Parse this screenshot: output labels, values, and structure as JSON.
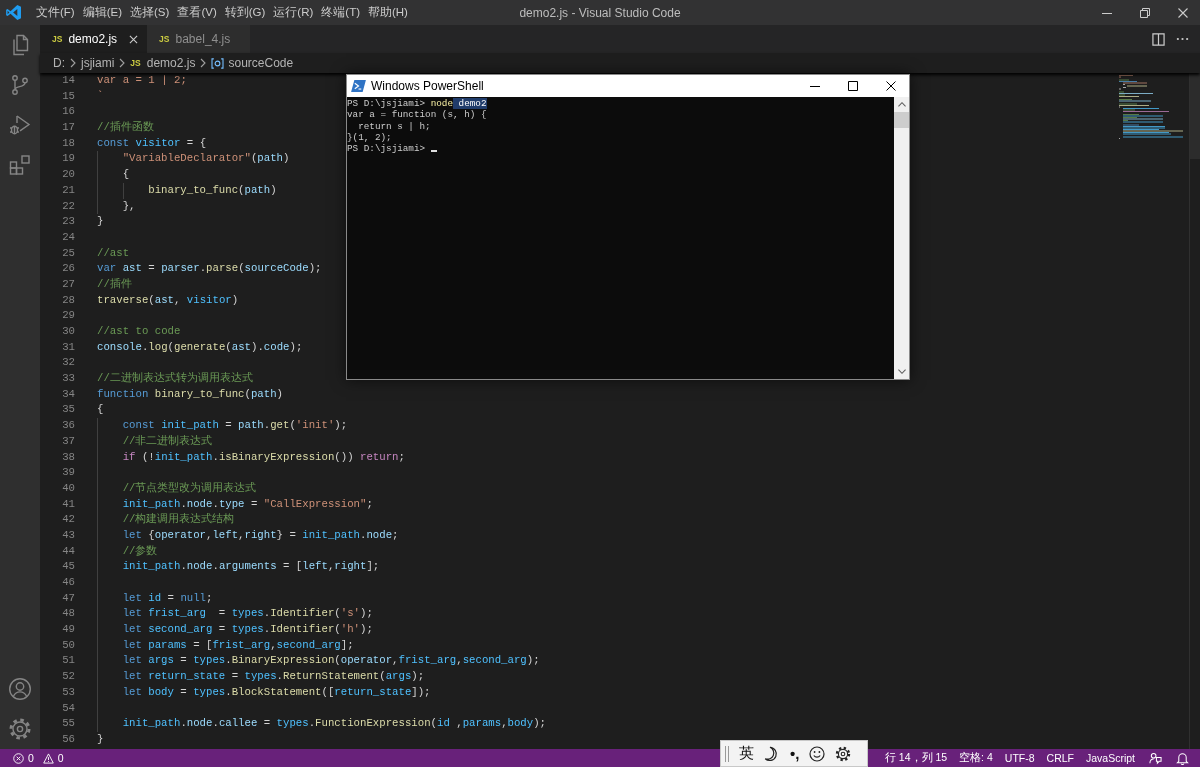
{
  "window": {
    "title": "demo2.js - Visual Studio Code"
  },
  "menu": [
    "文件(F)",
    "编辑(E)",
    "选择(S)",
    "查看(V)",
    "转到(G)",
    "运行(R)",
    "终端(T)",
    "帮助(H)"
  ],
  "tabs": [
    {
      "badge": "JS",
      "label": "demo2.js",
      "selected": true
    },
    {
      "badge": "JS",
      "label": "babel_4.js",
      "selected": false
    }
  ],
  "breadcrumbs": [
    {
      "kind": "folder",
      "label": "D:"
    },
    {
      "kind": "folder",
      "label": "jsjiami"
    },
    {
      "kind": "file",
      "badge": "JS",
      "label": "demo2.js"
    },
    {
      "kind": "symbol",
      "label": "sourceCode"
    }
  ],
  "editor": {
    "lines": [
      {
        "number": "14",
        "tokens": [
          {
            "kind": "string",
            "text": "var a = 1 | 2;"
          }
        ]
      },
      {
        "number": "15",
        "tokens": [
          {
            "kind": "string",
            "text": "`"
          }
        ]
      },
      {
        "number": "16"
      },
      {
        "number": "17",
        "tokens": [
          {
            "kind": "comment",
            "text": "//插件函数"
          }
        ]
      },
      {
        "number": "18",
        "tokens": [
          {
            "kind": "keyword",
            "text": "const "
          },
          {
            "kind": "constant",
            "text": "visitor"
          },
          {
            "kind": "plain",
            "text": " = {"
          }
        ],
        "children": [
          {
            "number": "19",
            "tokens": [
              {
                "kind": "string",
                "text": "\"VariableDeclarator\""
              },
              {
                "kind": "plain",
                "text": "("
              },
              {
                "kind": "variable",
                "text": "path"
              },
              {
                "kind": "plain",
                "text": ")"
              }
            ]
          },
          {
            "number": "20",
            "tokens": [
              {
                "kind": "plain",
                "text": "{"
              }
            ],
            "children": [
              {
                "number": "21",
                "tokens": [
                  {
                    "kind": "function",
                    "text": "binary_to_func"
                  },
                  {
                    "kind": "plain",
                    "text": "("
                  },
                  {
                    "kind": "variable",
                    "text": "path"
                  },
                  {
                    "kind": "plain",
                    "text": ")"
                  }
                ]
              }
            ]
          },
          {
            "number": "22",
            "tokens": [
              {
                "kind": "plain",
                "text": "},"
              }
            ]
          }
        ]
      },
      {
        "number": "23",
        "tokens": [
          {
            "kind": "plain",
            "text": "}"
          }
        ]
      },
      {
        "number": "24"
      },
      {
        "number": "25",
        "tokens": [
          {
            "kind": "comment",
            "text": "//ast"
          }
        ]
      },
      {
        "number": "26",
        "tokens": [
          {
            "kind": "keyword",
            "text": "var "
          },
          {
            "kind": "variable",
            "text": "ast"
          },
          {
            "kind": "plain",
            "text": " = "
          },
          {
            "kind": "variable",
            "text": "parser"
          },
          {
            "kind": "plain",
            "text": "."
          },
          {
            "kind": "function",
            "text": "parse"
          },
          {
            "kind": "plain",
            "text": "("
          },
          {
            "kind": "variable",
            "text": "sourceCode"
          },
          {
            "kind": "plain",
            "text": ");"
          }
        ]
      },
      {
        "number": "27",
        "tokens": [
          {
            "kind": "comment",
            "text": "//插件"
          }
        ]
      },
      {
        "number": "28",
        "tokens": [
          {
            "kind": "function",
            "text": "traverse"
          },
          {
            "kind": "plain",
            "text": "("
          },
          {
            "kind": "variable",
            "text": "ast"
          },
          {
            "kind": "plain",
            "text": ", "
          },
          {
            "kind": "constant",
            "text": "visitor"
          },
          {
            "kind": "plain",
            "text": ")"
          }
        ]
      },
      {
        "number": "29"
      },
      {
        "number": "30",
        "tokens": [
          {
            "kind": "comment",
            "text": "//ast to code"
          }
        ]
      },
      {
        "number": "31",
        "tokens": [
          {
            "kind": "variable",
            "text": "console"
          },
          {
            "kind": "plain",
            "text": "."
          },
          {
            "kind": "function",
            "text": "log"
          },
          {
            "kind": "plain",
            "text": "("
          },
          {
            "kind": "function",
            "text": "generate"
          },
          {
            "kind": "plain",
            "text": "("
          },
          {
            "kind": "variable",
            "text": "ast"
          },
          {
            "kind": "plain",
            "text": ")."
          },
          {
            "kind": "variable",
            "text": "code"
          },
          {
            "kind": "plain",
            "text": ");"
          }
        ]
      },
      {
        "number": "32"
      },
      {
        "number": "33",
        "tokens": [
          {
            "kind": "comment",
            "text": "//二进制表达式转为调用表达式"
          }
        ]
      },
      {
        "number": "34",
        "tokens": [
          {
            "kind": "keyword",
            "text": "function "
          },
          {
            "kind": "function",
            "text": "binary_to_func"
          },
          {
            "kind": "plain",
            "text": "("
          },
          {
            "kind": "variable",
            "text": "path"
          },
          {
            "kind": "plain",
            "text": ")"
          }
        ]
      },
      {
        "number": "35",
        "tokens": [
          {
            "kind": "plain",
            "text": "{"
          }
        ],
        "children": [
          {
            "number": "36",
            "tokens": [
              {
                "kind": "keyword",
                "text": "const "
              },
              {
                "kind": "constant",
                "text": "init_path"
              },
              {
                "kind": "plain",
                "text": " = "
              },
              {
                "kind": "variable",
                "text": "path"
              },
              {
                "kind": "plain",
                "text": "."
              },
              {
                "kind": "function",
                "text": "get"
              },
              {
                "kind": "plain",
                "text": "("
              },
              {
                "kind": "string",
                "text": "'init'"
              },
              {
                "kind": "plain",
                "text": ");"
              }
            ]
          },
          {
            "number": "37",
            "tokens": [
              {
                "kind": "comment",
                "text": "//非二进制表达式"
              }
            ]
          },
          {
            "number": "38",
            "tokens": [
              {
                "kind": "control",
                "text": "if "
              },
              {
                "kind": "plain",
                "text": "(!"
              },
              {
                "kind": "constant",
                "text": "init_path"
              },
              {
                "kind": "plain",
                "text": "."
              },
              {
                "kind": "function",
                "text": "isBinaryExpression"
              },
              {
                "kind": "plain",
                "text": "()) "
              },
              {
                "kind": "control",
                "text": "return"
              },
              {
                "kind": "plain",
                "text": ";"
              }
            ]
          },
          {
            "number": "39"
          },
          {
            "number": "40",
            "tokens": [
              {
                "kind": "comment",
                "text": "//节点类型改为调用表达式"
              }
            ]
          },
          {
            "number": "41",
            "tokens": [
              {
                "kind": "constant",
                "text": "init_path"
              },
              {
                "kind": "plain",
                "text": "."
              },
              {
                "kind": "variable",
                "text": "node"
              },
              {
                "kind": "plain",
                "text": "."
              },
              {
                "kind": "variable",
                "text": "type"
              },
              {
                "kind": "plain",
                "text": " = "
              },
              {
                "kind": "string",
                "text": "\"CallExpression\""
              },
              {
                "kind": "plain",
                "text": ";"
              }
            ]
          },
          {
            "number": "42",
            "tokens": [
              {
                "kind": "comment",
                "text": "//构建调用表达式结构"
              }
            ]
          },
          {
            "number": "43",
            "tokens": [
              {
                "kind": "keyword",
                "text": "let "
              },
              {
                "kind": "plain",
                "text": "{"
              },
              {
                "kind": "variable",
                "text": "operator"
              },
              {
                "kind": "plain",
                "text": ","
              },
              {
                "kind": "variable",
                "text": "left"
              },
              {
                "kind": "plain",
                "text": ","
              },
              {
                "kind": "variable",
                "text": "right"
              },
              {
                "kind": "plain",
                "text": "} = "
              },
              {
                "kind": "constant",
                "text": "init_path"
              },
              {
                "kind": "plain",
                "text": "."
              },
              {
                "kind": "variable",
                "text": "node"
              },
              {
                "kind": "plain",
                "text": ";"
              }
            ]
          },
          {
            "number": "44",
            "tokens": [
              {
                "kind": "comment",
                "text": "//参数"
              }
            ]
          },
          {
            "number": "45",
            "tokens": [
              {
                "kind": "constant",
                "text": "init_path"
              },
              {
                "kind": "plain",
                "text": "."
              },
              {
                "kind": "variable",
                "text": "node"
              },
              {
                "kind": "plain",
                "text": "."
              },
              {
                "kind": "variable",
                "text": "arguments"
              },
              {
                "kind": "plain",
                "text": " = ["
              },
              {
                "kind": "variable",
                "text": "left"
              },
              {
                "kind": "plain",
                "text": ","
              },
              {
                "kind": "variable",
                "text": "right"
              },
              {
                "kind": "plain",
                "text": "];"
              }
            ]
          },
          {
            "number": "46"
          },
          {
            "number": "47",
            "tokens": [
              {
                "kind": "keyword",
                "text": "let "
              },
              {
                "kind": "constant",
                "text": "id"
              },
              {
                "kind": "plain",
                "text": " = "
              },
              {
                "kind": "keyword",
                "text": "null"
              },
              {
                "kind": "plain",
                "text": ";"
              }
            ]
          },
          {
            "number": "48",
            "tokens": [
              {
                "kind": "keyword",
                "text": "let "
              },
              {
                "kind": "constant",
                "text": "frist_arg"
              },
              {
                "kind": "plain",
                "text": "  = "
              },
              {
                "kind": "constant",
                "text": "types"
              },
              {
                "kind": "plain",
                "text": "."
              },
              {
                "kind": "function",
                "text": "Identifier"
              },
              {
                "kind": "plain",
                "text": "("
              },
              {
                "kind": "string",
                "text": "'s'"
              },
              {
                "kind": "plain",
                "text": ");"
              }
            ]
          },
          {
            "number": "49",
            "tokens": [
              {
                "kind": "keyword",
                "text": "let "
              },
              {
                "kind": "constant",
                "text": "second_arg"
              },
              {
                "kind": "plain",
                "text": " = "
              },
              {
                "kind": "constant",
                "text": "types"
              },
              {
                "kind": "plain",
                "text": "."
              },
              {
                "kind": "function",
                "text": "Identifier"
              },
              {
                "kind": "plain",
                "text": "("
              },
              {
                "kind": "string",
                "text": "'h'"
              },
              {
                "kind": "plain",
                "text": ");"
              }
            ]
          },
          {
            "number": "50",
            "tokens": [
              {
                "kind": "keyword",
                "text": "let "
              },
              {
                "kind": "constant",
                "text": "params"
              },
              {
                "kind": "plain",
                "text": " = ["
              },
              {
                "kind": "constant",
                "text": "frist_arg"
              },
              {
                "kind": "plain",
                "text": ","
              },
              {
                "kind": "constant",
                "text": "second_arg"
              },
              {
                "kind": "plain",
                "text": "];"
              }
            ]
          },
          {
            "number": "51",
            "tokens": [
              {
                "kind": "keyword",
                "text": "let "
              },
              {
                "kind": "constant",
                "text": "args"
              },
              {
                "kind": "plain",
                "text": " = "
              },
              {
                "kind": "constant",
                "text": "types"
              },
              {
                "kind": "plain",
                "text": "."
              },
              {
                "kind": "function",
                "text": "BinaryExpression"
              },
              {
                "kind": "plain",
                "text": "("
              },
              {
                "kind": "variable",
                "text": "operator"
              },
              {
                "kind": "plain",
                "text": ","
              },
              {
                "kind": "constant",
                "text": "frist_arg"
              },
              {
                "kind": "plain",
                "text": ","
              },
              {
                "kind": "constant",
                "text": "second_arg"
              },
              {
                "kind": "plain",
                "text": ");"
              }
            ]
          },
          {
            "number": "52",
            "tokens": [
              {
                "kind": "keyword",
                "text": "let "
              },
              {
                "kind": "constant",
                "text": "return_state"
              },
              {
                "kind": "plain",
                "text": " = "
              },
              {
                "kind": "constant",
                "text": "types"
              },
              {
                "kind": "plain",
                "text": "."
              },
              {
                "kind": "function",
                "text": "ReturnStatement"
              },
              {
                "kind": "plain",
                "text": "("
              },
              {
                "kind": "constant",
                "text": "args"
              },
              {
                "kind": "plain",
                "text": ");"
              }
            ]
          },
          {
            "number": "53",
            "tokens": [
              {
                "kind": "keyword",
                "text": "let "
              },
              {
                "kind": "constant",
                "text": "body"
              },
              {
                "kind": "plain",
                "text": " = "
              },
              {
                "kind": "constant",
                "text": "types"
              },
              {
                "kind": "plain",
                "text": "."
              },
              {
                "kind": "function",
                "text": "BlockStatement"
              },
              {
                "kind": "plain",
                "text": "(["
              },
              {
                "kind": "constant",
                "text": "return_state"
              },
              {
                "kind": "plain",
                "text": "]);"
              }
            ]
          },
          {
            "number": "54"
          },
          {
            "number": "55",
            "tokens": [
              {
                "kind": "constant",
                "text": "init_path"
              },
              {
                "kind": "plain",
                "text": "."
              },
              {
                "kind": "variable",
                "text": "node"
              },
              {
                "kind": "plain",
                "text": "."
              },
              {
                "kind": "variable",
                "text": "callee"
              },
              {
                "kind": "plain",
                "text": " = "
              },
              {
                "kind": "constant",
                "text": "types"
              },
              {
                "kind": "plain",
                "text": "."
              },
              {
                "kind": "function",
                "text": "FunctionExpression"
              },
              {
                "kind": "plain",
                "text": "("
              },
              {
                "kind": "constant",
                "text": "id"
              },
              {
                "kind": "plain",
                "text": " ,"
              },
              {
                "kind": "constant",
                "text": "params"
              },
              {
                "kind": "plain",
                "text": ","
              },
              {
                "kind": "constant",
                "text": "body"
              },
              {
                "kind": "plain",
                "text": ");"
              }
            ]
          }
        ]
      },
      {
        "number": "56",
        "tokens": [
          {
            "kind": "plain",
            "text": "}"
          }
        ]
      }
    ]
  },
  "terminal": {
    "title": "Windows PowerShell",
    "lines": [
      {
        "segments": [
          {
            "kind": "output",
            "text": "PS D:\\jsjiami> ",
            "selected": false
          },
          {
            "kind": "command",
            "text": "node",
            "selected": false
          },
          {
            "kind": "output",
            "text": " demo2",
            "selected": true
          }
        ],
        "cursor": false
      },
      {
        "segments": [
          {
            "kind": "output",
            "text": "var a = function (s, h) {",
            "selected": false
          }
        ],
        "cursor": false
      },
      {
        "segments": [
          {
            "kind": "output",
            "text": "  return s | h;",
            "selected": false
          }
        ],
        "cursor": false
      },
      {
        "segments": [
          {
            "kind": "output",
            "text": "}(1, 2);",
            "selected": false
          }
        ],
        "cursor": false
      },
      {
        "segments": [
          {
            "kind": "output",
            "text": "PS D:\\jsjiami> ",
            "selected": false
          }
        ],
        "cursor": true
      }
    ]
  },
  "status_bar": {
    "errors": "0",
    "warnings": "0",
    "items": [
      "行 14，列 15",
      "空格: 4",
      "UTF-8",
      "CRLF",
      "JavaScript"
    ]
  },
  "ime_toolbar": {
    "mode": "英",
    "punctuation": "•,"
  }
}
